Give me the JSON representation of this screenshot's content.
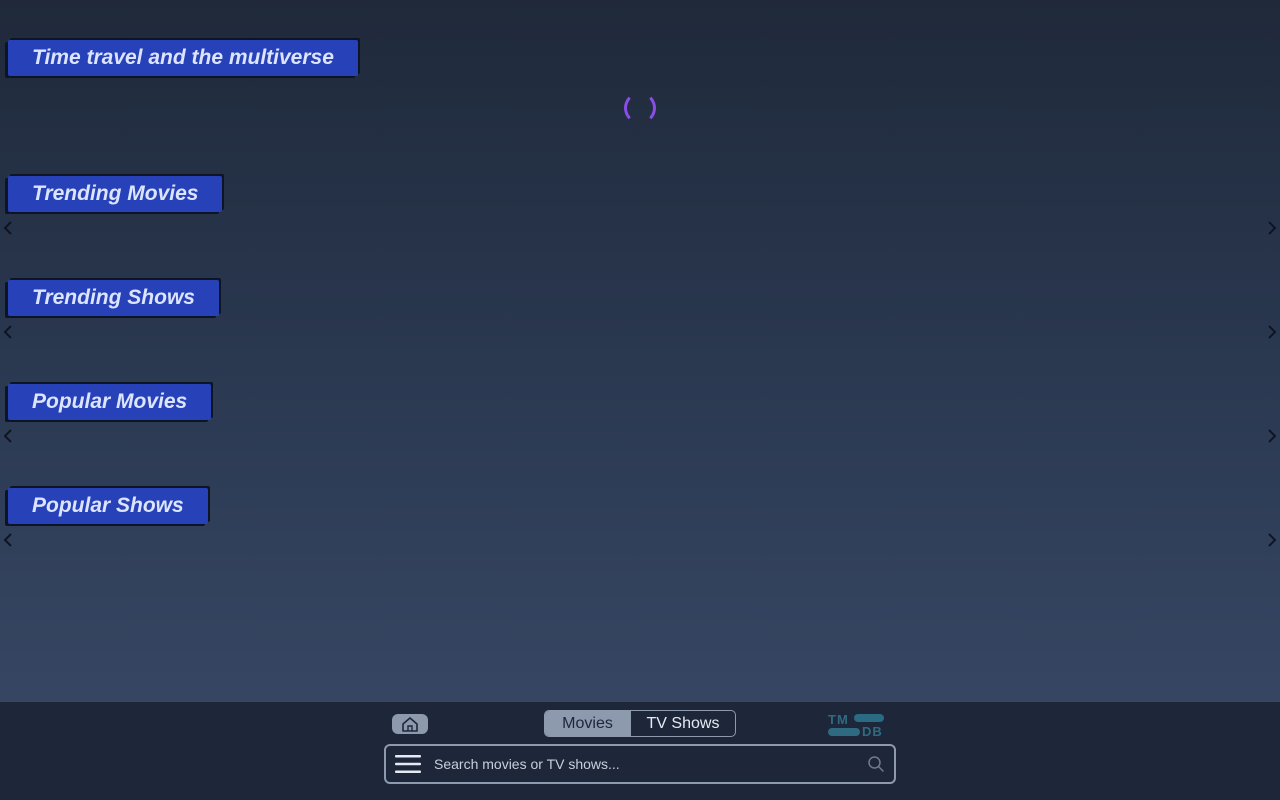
{
  "sections": {
    "featured": "Time travel and the multiverse",
    "trending_movies": "Trending Movies",
    "trending_shows": "Trending Shows",
    "popular_movies": "Popular Movies",
    "popular_shows": "Popular Shows"
  },
  "icons": {
    "spinner": "loading-spinner",
    "prev": "chevron-left-icon",
    "next": "chevron-right-icon",
    "home": "home-icon",
    "menu": "hamburger-menu-icon",
    "search": "search-icon"
  },
  "footer": {
    "toggle": {
      "movies": "Movies",
      "tv_shows": "TV Shows",
      "selected": "Movies"
    },
    "logo": {
      "line1": "TM",
      "line2": "DB"
    },
    "search": {
      "placeholder": "Search movies or TV shows..."
    }
  },
  "colors": {
    "heading_bg": "#2742b8",
    "spinner": "#8a4de8",
    "footer_bg": "#1e2739",
    "control": "#8d99ad",
    "tmdb": "#2e6b80"
  }
}
